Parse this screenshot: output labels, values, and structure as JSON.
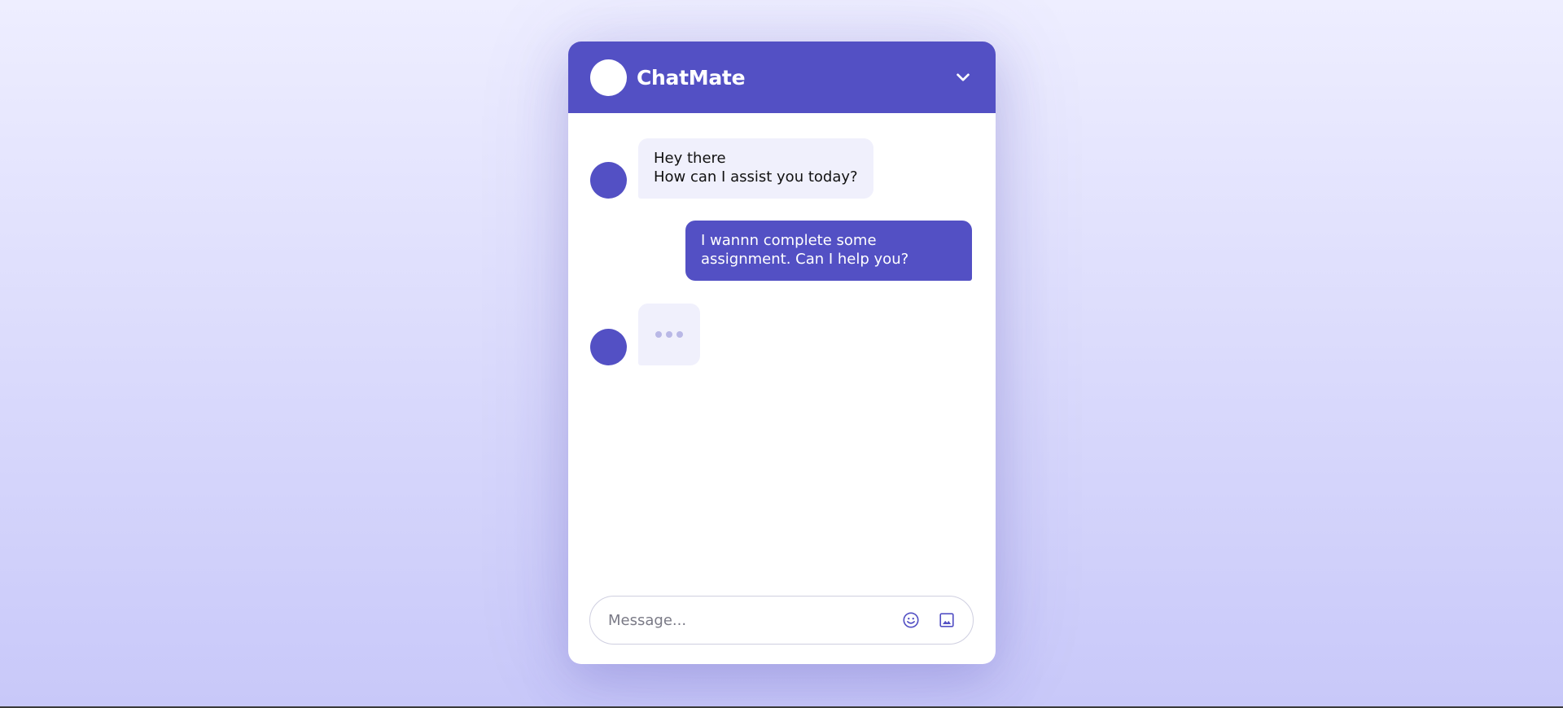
{
  "header": {
    "title": "ChatMate",
    "collapse_icon": "chevron-down-icon"
  },
  "messages": [
    {
      "sender": "bot",
      "lines": [
        "Hey there",
        "How can I assist you today?"
      ]
    },
    {
      "sender": "user",
      "lines": [
        "I wannn complete some",
        "assignment. Can I help you?"
      ]
    }
  ],
  "typing_indicator": {
    "sender": "bot",
    "visible": true
  },
  "composer": {
    "placeholder": "Message...",
    "emoji_icon": "emoji-icon",
    "image_icon": "image-icon"
  },
  "colors": {
    "accent": "#5350c4",
    "bot_bubble": "#f0f0fc",
    "background_top": "#eeeeff",
    "background_bottom": "#c8c8f9"
  }
}
